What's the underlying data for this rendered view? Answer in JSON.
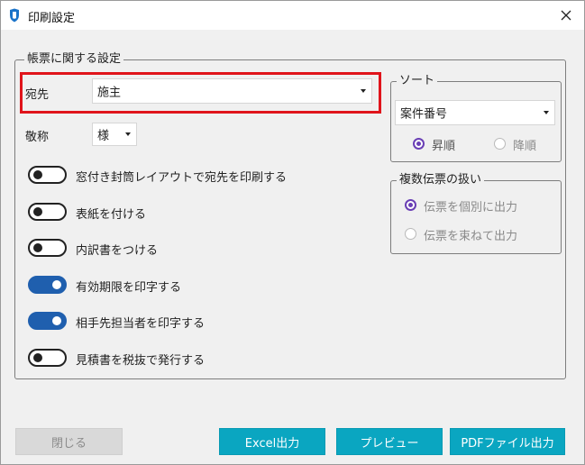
{
  "window": {
    "title": "印刷設定",
    "close_icon": "close-icon",
    "app_icon": "shield-icon"
  },
  "main_group": {
    "legend": "帳票に関する設定",
    "recipient_label": "宛先",
    "recipient_value": "施主",
    "honorific_label": "敬称",
    "honorific_value": "様",
    "toggles": [
      {
        "label": "窓付き封筒レイアウトで宛先を印刷する",
        "on": false
      },
      {
        "label": "表紙を付ける",
        "on": false
      },
      {
        "label": "内訳書をつける",
        "on": false
      },
      {
        "label": "有効期限を印字する",
        "on": true
      },
      {
        "label": "相手先担当者を印字する",
        "on": true
      },
      {
        "label": "見積書を税抜で発行する",
        "on": false
      }
    ]
  },
  "sort_group": {
    "legend": "ソート",
    "sort_value": "案件番号",
    "ascending_label": "昇順",
    "descending_label": "降順",
    "selected": "昇順"
  },
  "multi_group": {
    "legend": "複数伝票の扱い",
    "individual_label": "伝票を個別に出力",
    "bundle_label": "伝票を束ねて出力",
    "selected": "伝票を個別に出力"
  },
  "buttons": {
    "close": "閉じる",
    "excel": "Excel出力",
    "preview": "プレビュー",
    "pdf": "PDFファイル出力"
  },
  "colors": {
    "accent_button": "#0aa6c1",
    "toggle_on": "#1f5fae",
    "radio_checked": "#6a3fb5",
    "highlight_border": "#e0141b"
  }
}
